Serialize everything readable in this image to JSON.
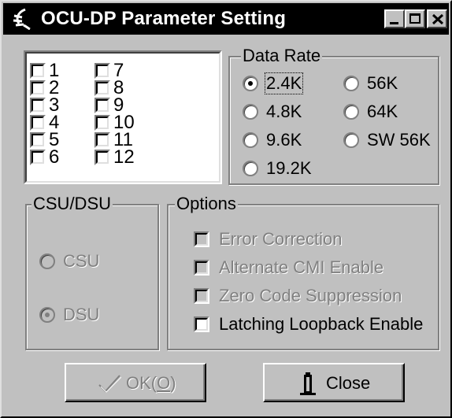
{
  "window": {
    "title": "OCU-DP Parameter Setting"
  },
  "channels": {
    "items": [
      {
        "label": "1",
        "checked": false
      },
      {
        "label": "2",
        "checked": false
      },
      {
        "label": "3",
        "checked": false
      },
      {
        "label": "4",
        "checked": false
      },
      {
        "label": "5",
        "checked": false
      },
      {
        "label": "6",
        "checked": false
      },
      {
        "label": "7",
        "checked": false
      },
      {
        "label": "8",
        "checked": false
      },
      {
        "label": "9",
        "checked": false
      },
      {
        "label": "10",
        "checked": false
      },
      {
        "label": "11",
        "checked": false
      },
      {
        "label": "12",
        "checked": false
      }
    ]
  },
  "data_rate": {
    "legend": "Data Rate",
    "options": [
      {
        "label": "2.4K",
        "selected": true
      },
      {
        "label": "4.8K",
        "selected": false
      },
      {
        "label": "9.6K",
        "selected": false
      },
      {
        "label": "19.2K",
        "selected": false
      },
      {
        "label": "56K",
        "selected": false
      },
      {
        "label": "64K",
        "selected": false
      },
      {
        "label": "SW 56K",
        "selected": false
      }
    ]
  },
  "csu_dsu": {
    "legend": "CSU/DSU",
    "options": [
      {
        "label": "CSU",
        "selected": false,
        "enabled": false
      },
      {
        "label": "DSU",
        "selected": true,
        "enabled": false
      }
    ]
  },
  "options": {
    "legend": "Options",
    "items": [
      {
        "label": "Error Correction",
        "checked": false,
        "enabled": false
      },
      {
        "label": "Alternate CMI Enable",
        "checked": false,
        "enabled": false
      },
      {
        "label": "Zero Code Suppression",
        "checked": false,
        "enabled": false
      },
      {
        "label": "Latching Loopback Enable",
        "checked": false,
        "enabled": true
      }
    ]
  },
  "buttons": {
    "ok_prefix": "OK(",
    "ok_key": "O",
    "ok_suffix": ")",
    "close_label": "Close",
    "ok_enabled": false
  },
  "icons": {
    "app": "app-icon",
    "ok": "checkmark-icon",
    "close": "door-exit-icon"
  }
}
